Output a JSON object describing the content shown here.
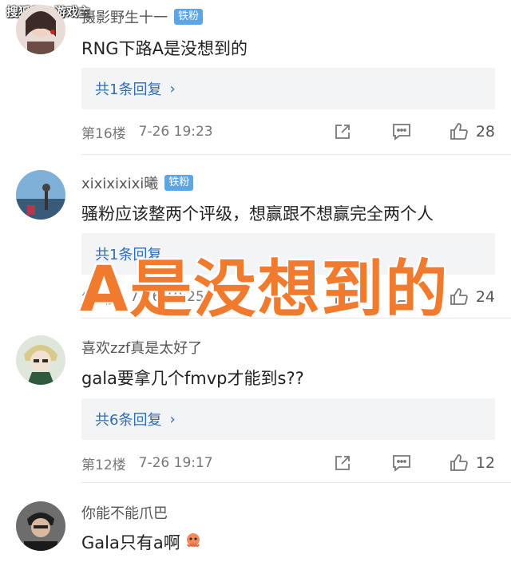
{
  "watermark": "搜狐号@游戏主",
  "overlay_text": "A是没想到的",
  "comments": [
    {
      "username": "摄影野生十一",
      "badge": "铁粉",
      "text": "RNG下路A是没想到的",
      "replies": "共1条回复",
      "floor": "第16楼",
      "time": "7-26 19:23",
      "likes": "28"
    },
    {
      "username": "xixixixixi曦",
      "badge": "铁粉",
      "text": "骚粉应该整两个评级，想赢跟不想赢完全两个人",
      "replies": "共1条回复",
      "floor": "第7楼",
      "time": "7-26 19:25",
      "likes": "24"
    },
    {
      "username": "喜欢zzf真是太好了",
      "text": "gala要拿几个fmvp才能到s??",
      "replies": "共6条回复",
      "floor": "第12楼",
      "time": "7-26 19:17",
      "likes": "12"
    },
    {
      "username": "你能不能爪巴",
      "text": "Gala只有a啊"
    }
  ],
  "colors": {
    "badge": "#5aa6e6",
    "reply_link": "#2f6eb5",
    "overlay": "#f07a2e"
  }
}
